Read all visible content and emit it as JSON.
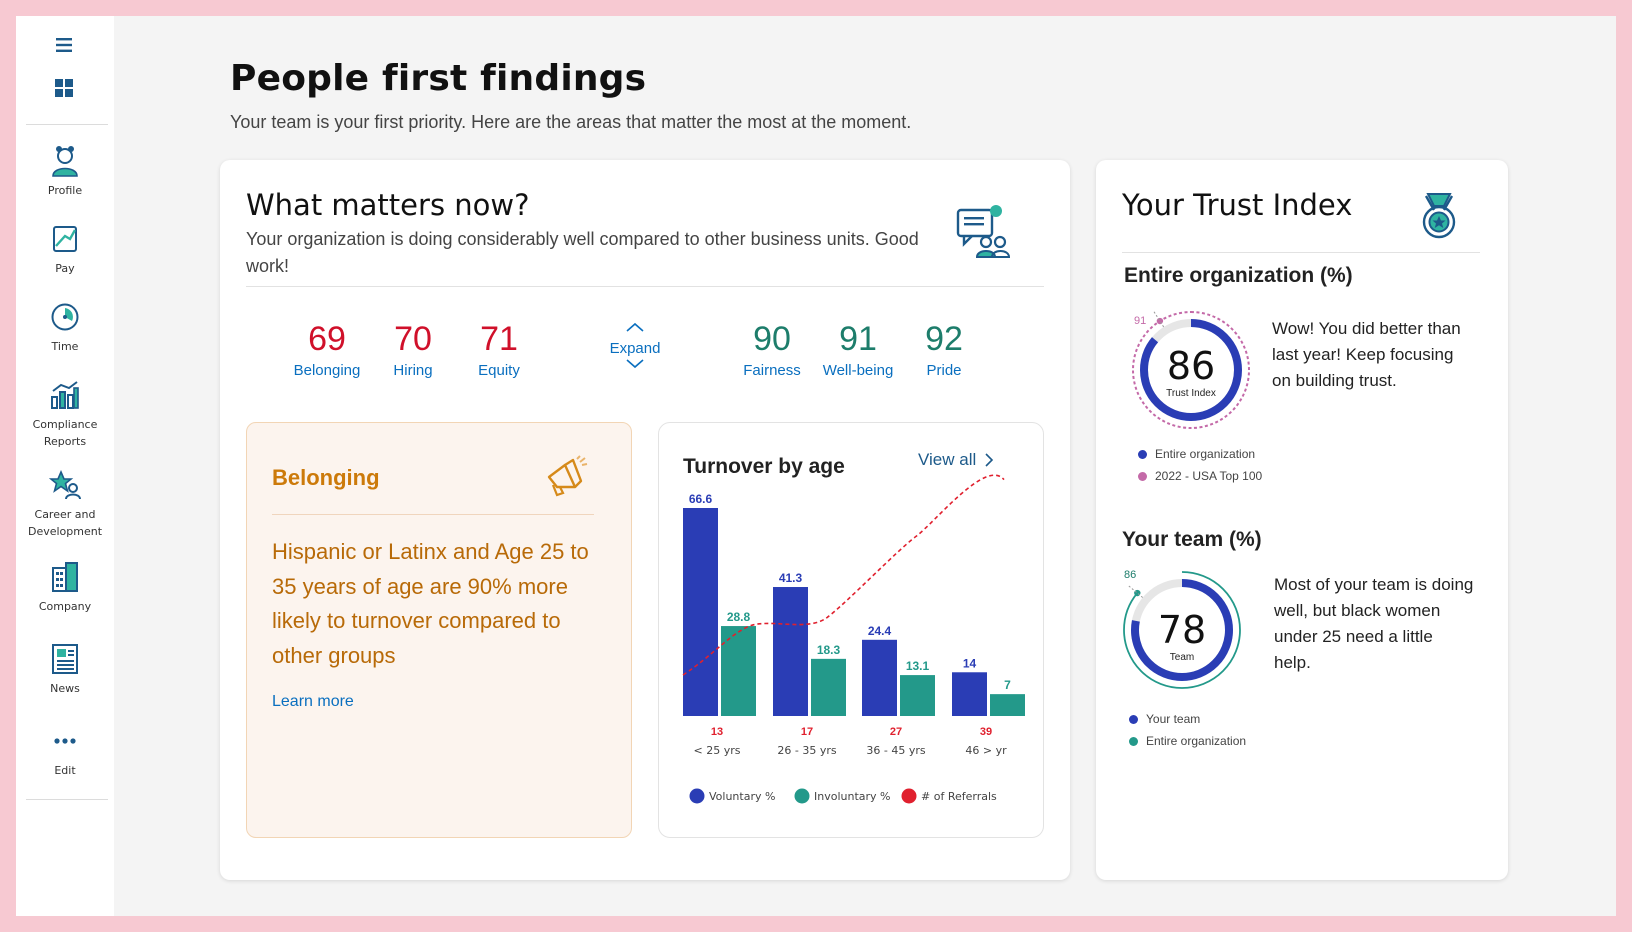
{
  "sidebar": {
    "items": [
      {
        "label": "Profile",
        "icon": "profile-icon"
      },
      {
        "label": "Pay",
        "icon": "pay-icon"
      },
      {
        "label": "Time",
        "icon": "clock-icon"
      },
      {
        "label": "Compliance Reports",
        "icon": "bar-chart-icon"
      },
      {
        "label": "Career and Development",
        "icon": "career-icon"
      },
      {
        "label": "Company",
        "icon": "building-icon"
      },
      {
        "label": "News",
        "icon": "news-icon"
      },
      {
        "label": "Edit",
        "icon": "more-icon"
      }
    ]
  },
  "header": {
    "title": "People first findings",
    "subtitle": "Your team is your first priority. Here are the areas that matter the most at the moment."
  },
  "matters": {
    "title": "What matters now?",
    "description": "Your organization is doing considerably well compared to other business units. Good work!",
    "expand_label": "Expand",
    "low_scores": [
      {
        "value": "69",
        "label": "Belonging"
      },
      {
        "value": "70",
        "label": "Hiring"
      },
      {
        "value": "71",
        "label": "Equity"
      }
    ],
    "high_scores": [
      {
        "value": "90",
        "label": "Fairness"
      },
      {
        "value": "91",
        "label": "Well-being"
      },
      {
        "value": "92",
        "label": "Pride"
      }
    ]
  },
  "belonging": {
    "title": "Belonging",
    "text": "Hispanic or Latinx and Age 25 to 35 years of age are 90% more likely to turnover compared to other groups",
    "link": "Learn more"
  },
  "turnover": {
    "title": "Turnover by age",
    "view_all": "View all"
  },
  "chart_data": {
    "type": "bar",
    "title": "Turnover by age",
    "categories": [
      "< 25 yrs",
      "26 - 35 yrs",
      "36 - 45 yrs",
      "46 > yr"
    ],
    "series": [
      {
        "name": "Voluntary %",
        "values": [
          66.6,
          41.3,
          24.4,
          14
        ],
        "color": "#2a3db5"
      },
      {
        "name": "Involuntary %",
        "values": [
          28.8,
          18.3,
          13.1,
          7
        ],
        "color": "#23998a"
      },
      {
        "name": "# of Referrals",
        "values": [
          13,
          17,
          27,
          39
        ],
        "color": "#e0202e",
        "style": "dashed-line"
      }
    ],
    "ylim": [
      0,
      70
    ],
    "legend": "bottom",
    "grid": false
  },
  "trust": {
    "title": "Your Trust Index",
    "org": {
      "title": "Entire organization (%)",
      "value": 86,
      "value_text": "86",
      "caption": "Trust Index",
      "benchmark": 91,
      "benchmark_text": "91",
      "message": "Wow! You did better than last year! Keep focusing on building trust.",
      "legend": [
        {
          "label": "Entire organization",
          "color": "#2a3db5"
        },
        {
          "label": "2022 - USA Top 100",
          "color": "#c46aa8"
        }
      ]
    },
    "team": {
      "title": "Your team (%)",
      "value": 78,
      "value_text": "78",
      "caption": "Team",
      "benchmark": 86,
      "benchmark_text": "86",
      "message": "Most of your team is doing well, but black women under 25 need a little help.",
      "legend": [
        {
          "label": "Your team",
          "color": "#2a3db5"
        },
        {
          "label": "Entire organization",
          "color": "#23998a"
        }
      ]
    }
  }
}
